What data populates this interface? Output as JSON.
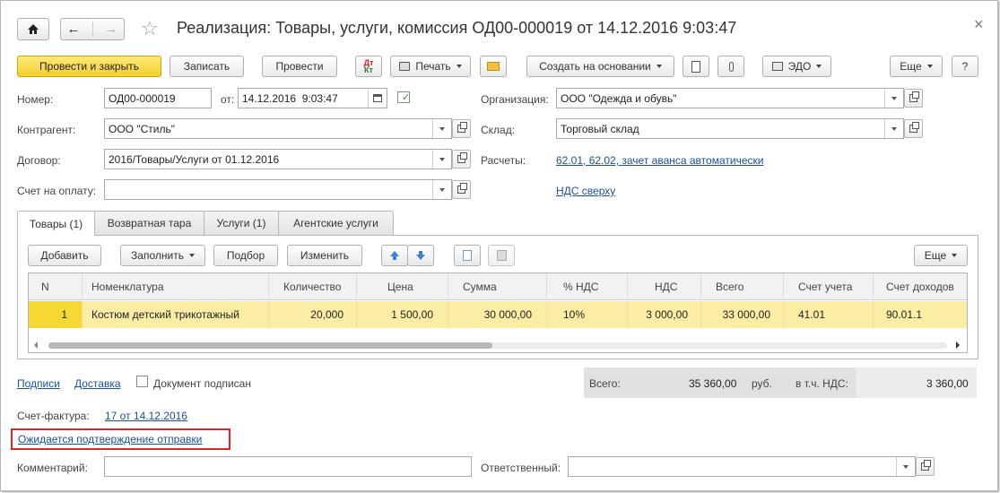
{
  "window": {
    "title": "Реализация: Товары, услуги, комиссия ОД00-000019 от 14.12.2016 9:03:47"
  },
  "toolbar": {
    "post_close": "Провести и закрыть",
    "save": "Записать",
    "post": "Провести",
    "print": "Печать",
    "create_based": "Создать на основании",
    "edo": "ЭДО",
    "more": "Еще",
    "help": "?"
  },
  "form": {
    "number_label": "Номер:",
    "number_value": "ОД00-000019",
    "from_label": "от:",
    "date_value": "14.12.2016  9:03:47",
    "org_label": "Организация:",
    "org_value": "ООО \"Одежда и обувь\"",
    "counterparty_label": "Контрагент:",
    "counterparty_value": "ООО \"Стиль\"",
    "warehouse_label": "Склад:",
    "warehouse_value": "Торговый склад",
    "contract_label": "Договор:",
    "contract_value": "2016/Товары/Услуги от 01.12.2016",
    "settlements_label": "Расчеты:",
    "settlements_link": "62.01, 62.02, зачет аванса автоматически",
    "invoice_pay_label": "Счет на оплату:",
    "invoice_pay_value": "",
    "vat_link": "НДС сверху"
  },
  "tabs": [
    "Товары (1)",
    "Возвратная тара",
    "Услуги (1)",
    "Агентские услуги"
  ],
  "table_toolbar": {
    "add": "Добавить",
    "fill": "Заполнить",
    "pick": "Подбор",
    "change": "Изменить",
    "more": "Еще"
  },
  "table": {
    "columns": [
      "N",
      "Номенклатура",
      "Количество",
      "Цена",
      "Сумма",
      "% НДС",
      "НДС",
      "Всего",
      "Счет учета",
      "Счет доходов"
    ],
    "rows": [
      [
        "1",
        "Костюм детский трикотажный",
        "20,000",
        "1 500,00",
        "30 000,00",
        "10%",
        "3 000,00",
        "33 000,00",
        "41.01",
        "90.01.1"
      ]
    ]
  },
  "footer": {
    "signatures_link": "Подписи",
    "delivery_link": "Доставка",
    "signed_label": "Документ подписан",
    "total_label": "Всего:",
    "total_value": "35 360,00",
    "currency": "руб.",
    "vat_label": "в т.ч. НДС:",
    "vat_value": "3 360,00",
    "invoice_label": "Счет-фактура:",
    "invoice_link": "17 от 14.12.2016",
    "awaiting_link": "Ожидается подтверждение отправки",
    "comment_label": "Комментарий:",
    "comment_value": "",
    "responsible_label": "Ответственный:",
    "responsible_value": ""
  },
  "colors": {
    "accent_button": "#f5cf2c",
    "selected_row": "#fbeea4",
    "link": "#1c4fa0",
    "highlight_frame": "#d9262c"
  }
}
